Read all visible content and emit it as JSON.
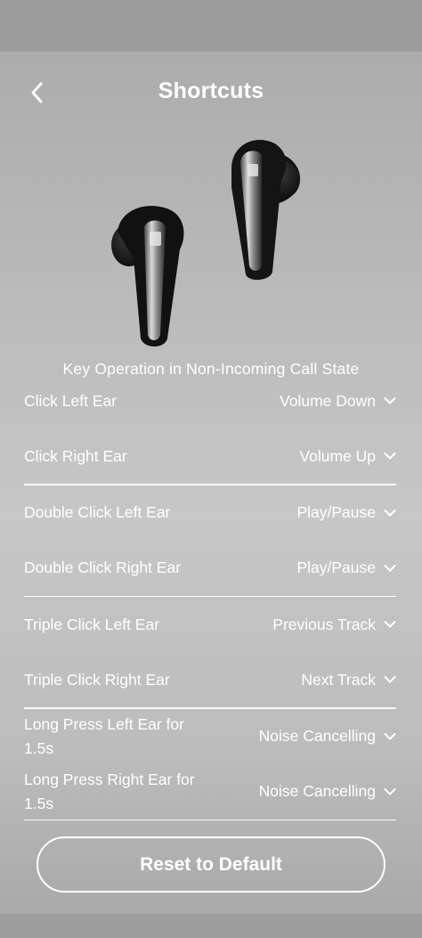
{
  "header": {
    "title": "Shortcuts"
  },
  "section": {
    "caption": "Key Operation in Non-Incoming Call State"
  },
  "shortcuts": [
    {
      "label": "Click Left Ear",
      "value": "Volume Down"
    },
    {
      "label": "Click Right Ear",
      "value": "Volume Up"
    },
    {
      "label": "Double Click Left Ear",
      "value": "Play/Pause"
    },
    {
      "label": "Double Click Right Ear",
      "value": "Play/Pause"
    },
    {
      "label": "Triple Click Left Ear",
      "value": "Previous Track"
    },
    {
      "label": "Triple Click Right Ear",
      "value": "Next Track"
    },
    {
      "label": "Long Press Left Ear for 1.5s",
      "value": "Noise Cancelling"
    },
    {
      "label": "Long Press Right Ear for 1.5s",
      "value": "Noise Cancelling"
    }
  ],
  "footer": {
    "reset_label": "Reset to Default"
  },
  "icons": {
    "back": "chevron-left-icon",
    "dropdown": "chevron-down-icon",
    "product": "earbuds-image"
  },
  "colors": {
    "text": "#ffffff",
    "background": "#bdbdbd"
  }
}
